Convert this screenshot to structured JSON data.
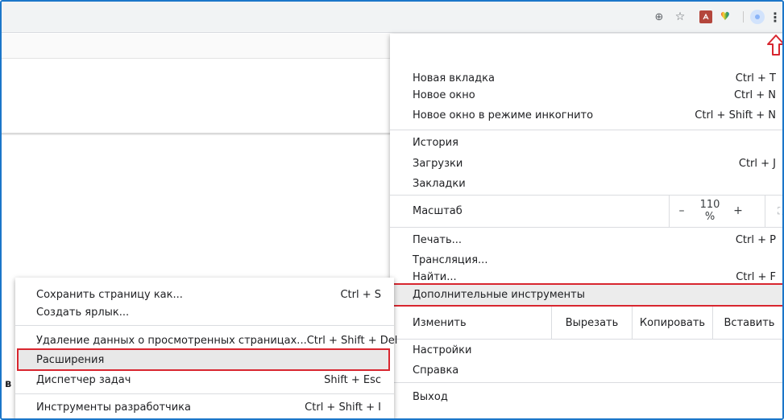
{
  "toolbar": {
    "icons": [
      "zoom-icon",
      "star-icon",
      "pdf-extension-icon",
      "heart-extension-icon",
      "profile-icon",
      "menu-dots-icon"
    ],
    "menu_glyph": "⋮",
    "zoom_glyph": "⊕",
    "star_glyph": "☆",
    "heart_glyph": "♥"
  },
  "page": {
    "partial_letter": "в"
  },
  "menu": {
    "new_tab": {
      "label": "Новая вкладка",
      "shortcut": "Ctrl + T"
    },
    "new_window": {
      "label": "Новое окно",
      "shortcut": "Ctrl + N"
    },
    "incognito": {
      "label": "Новое окно в режиме инкогнито",
      "shortcut": "Ctrl + Shift + N"
    },
    "history": {
      "label": "История"
    },
    "downloads": {
      "label": "Загрузки",
      "shortcut": "Ctrl + J"
    },
    "bookmarks": {
      "label": "Закладки"
    },
    "zoom": {
      "label": "Масштаб",
      "minus": "–",
      "value": "110 %",
      "plus": "+",
      "fullscreen": "⛶"
    },
    "print": {
      "label": "Печать...",
      "shortcut": "Ctrl + P"
    },
    "cast": {
      "label": "Трансляция..."
    },
    "find": {
      "label": "Найти...",
      "shortcut": "Ctrl + F"
    },
    "more_tools": {
      "label": "Дополнительные инструменты"
    },
    "edit": {
      "label": "Изменить",
      "cut": "Вырезать",
      "copy": "Копировать",
      "paste": "Вставить"
    },
    "settings": {
      "label": "Настройки"
    },
    "help": {
      "label": "Справка"
    },
    "exit": {
      "label": "Выход"
    }
  },
  "submenu": {
    "save_page": {
      "label": "Сохранить страницу как...",
      "shortcut": "Ctrl + S"
    },
    "create_shortcut": {
      "label": "Создать ярлык..."
    },
    "clear_data": {
      "label": "Удаление данных о просмотренных страницах...",
      "shortcut": "Ctrl + Shift + Del"
    },
    "extensions": {
      "label": "Расширения"
    },
    "task_manager": {
      "label": "Диспетчер задач",
      "shortcut": "Shift + Esc"
    },
    "dev_tools": {
      "label": "Инструменты разработчика",
      "shortcut": "Ctrl + Shift + I"
    }
  },
  "colors": {
    "highlight_border": "#d8262f",
    "window_border": "#1b76c9",
    "highlight_bg": "#ececec"
  }
}
